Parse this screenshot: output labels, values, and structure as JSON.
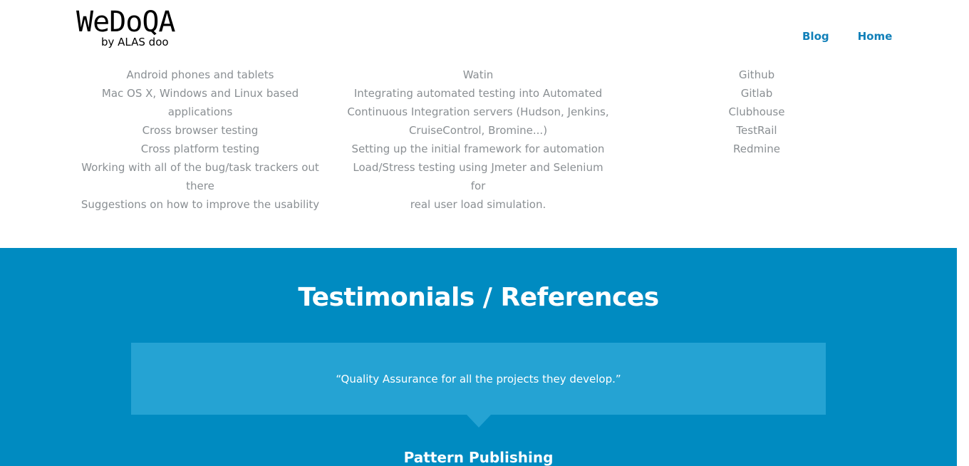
{
  "header": {
    "logo_title": "WeDoQA",
    "logo_subtitle": "by ALAS doo",
    "nav": [
      {
        "label": "Blog"
      },
      {
        "label": "Home"
      }
    ]
  },
  "lists": {
    "col1": [
      "Android phones and tablets",
      "Mac OS X, Windows and Linux based applications",
      "Cross browser testing",
      "Cross platform testing",
      "Working with all of the bug/task trackers out there",
      "Suggestions on how to improve the usability"
    ],
    "col2": [
      "Watin",
      "Integrating automated testing into Automated",
      "Continuous Integration servers (Hudson, Jenkins,",
      "CruiseControl, Bromine...)",
      "Setting up the initial framework for automation",
      "Load/Stress testing using Jmeter and Selenium for",
      "real user load simulation."
    ],
    "col3": [
      "Github",
      "Gitlab",
      "Clubhouse",
      "TestRail",
      "Redmine"
    ]
  },
  "testimonials": {
    "title": "Testimonials / References",
    "quote": "“Quality Assurance for all the projects they develop.”",
    "author": "Pattern Publishing"
  },
  "colors": {
    "nav_link": "#1180b9",
    "list_text": "#8a8f93",
    "testimonial_bg": "#008bc1",
    "quote_box_bg": "#25a3d3"
  }
}
